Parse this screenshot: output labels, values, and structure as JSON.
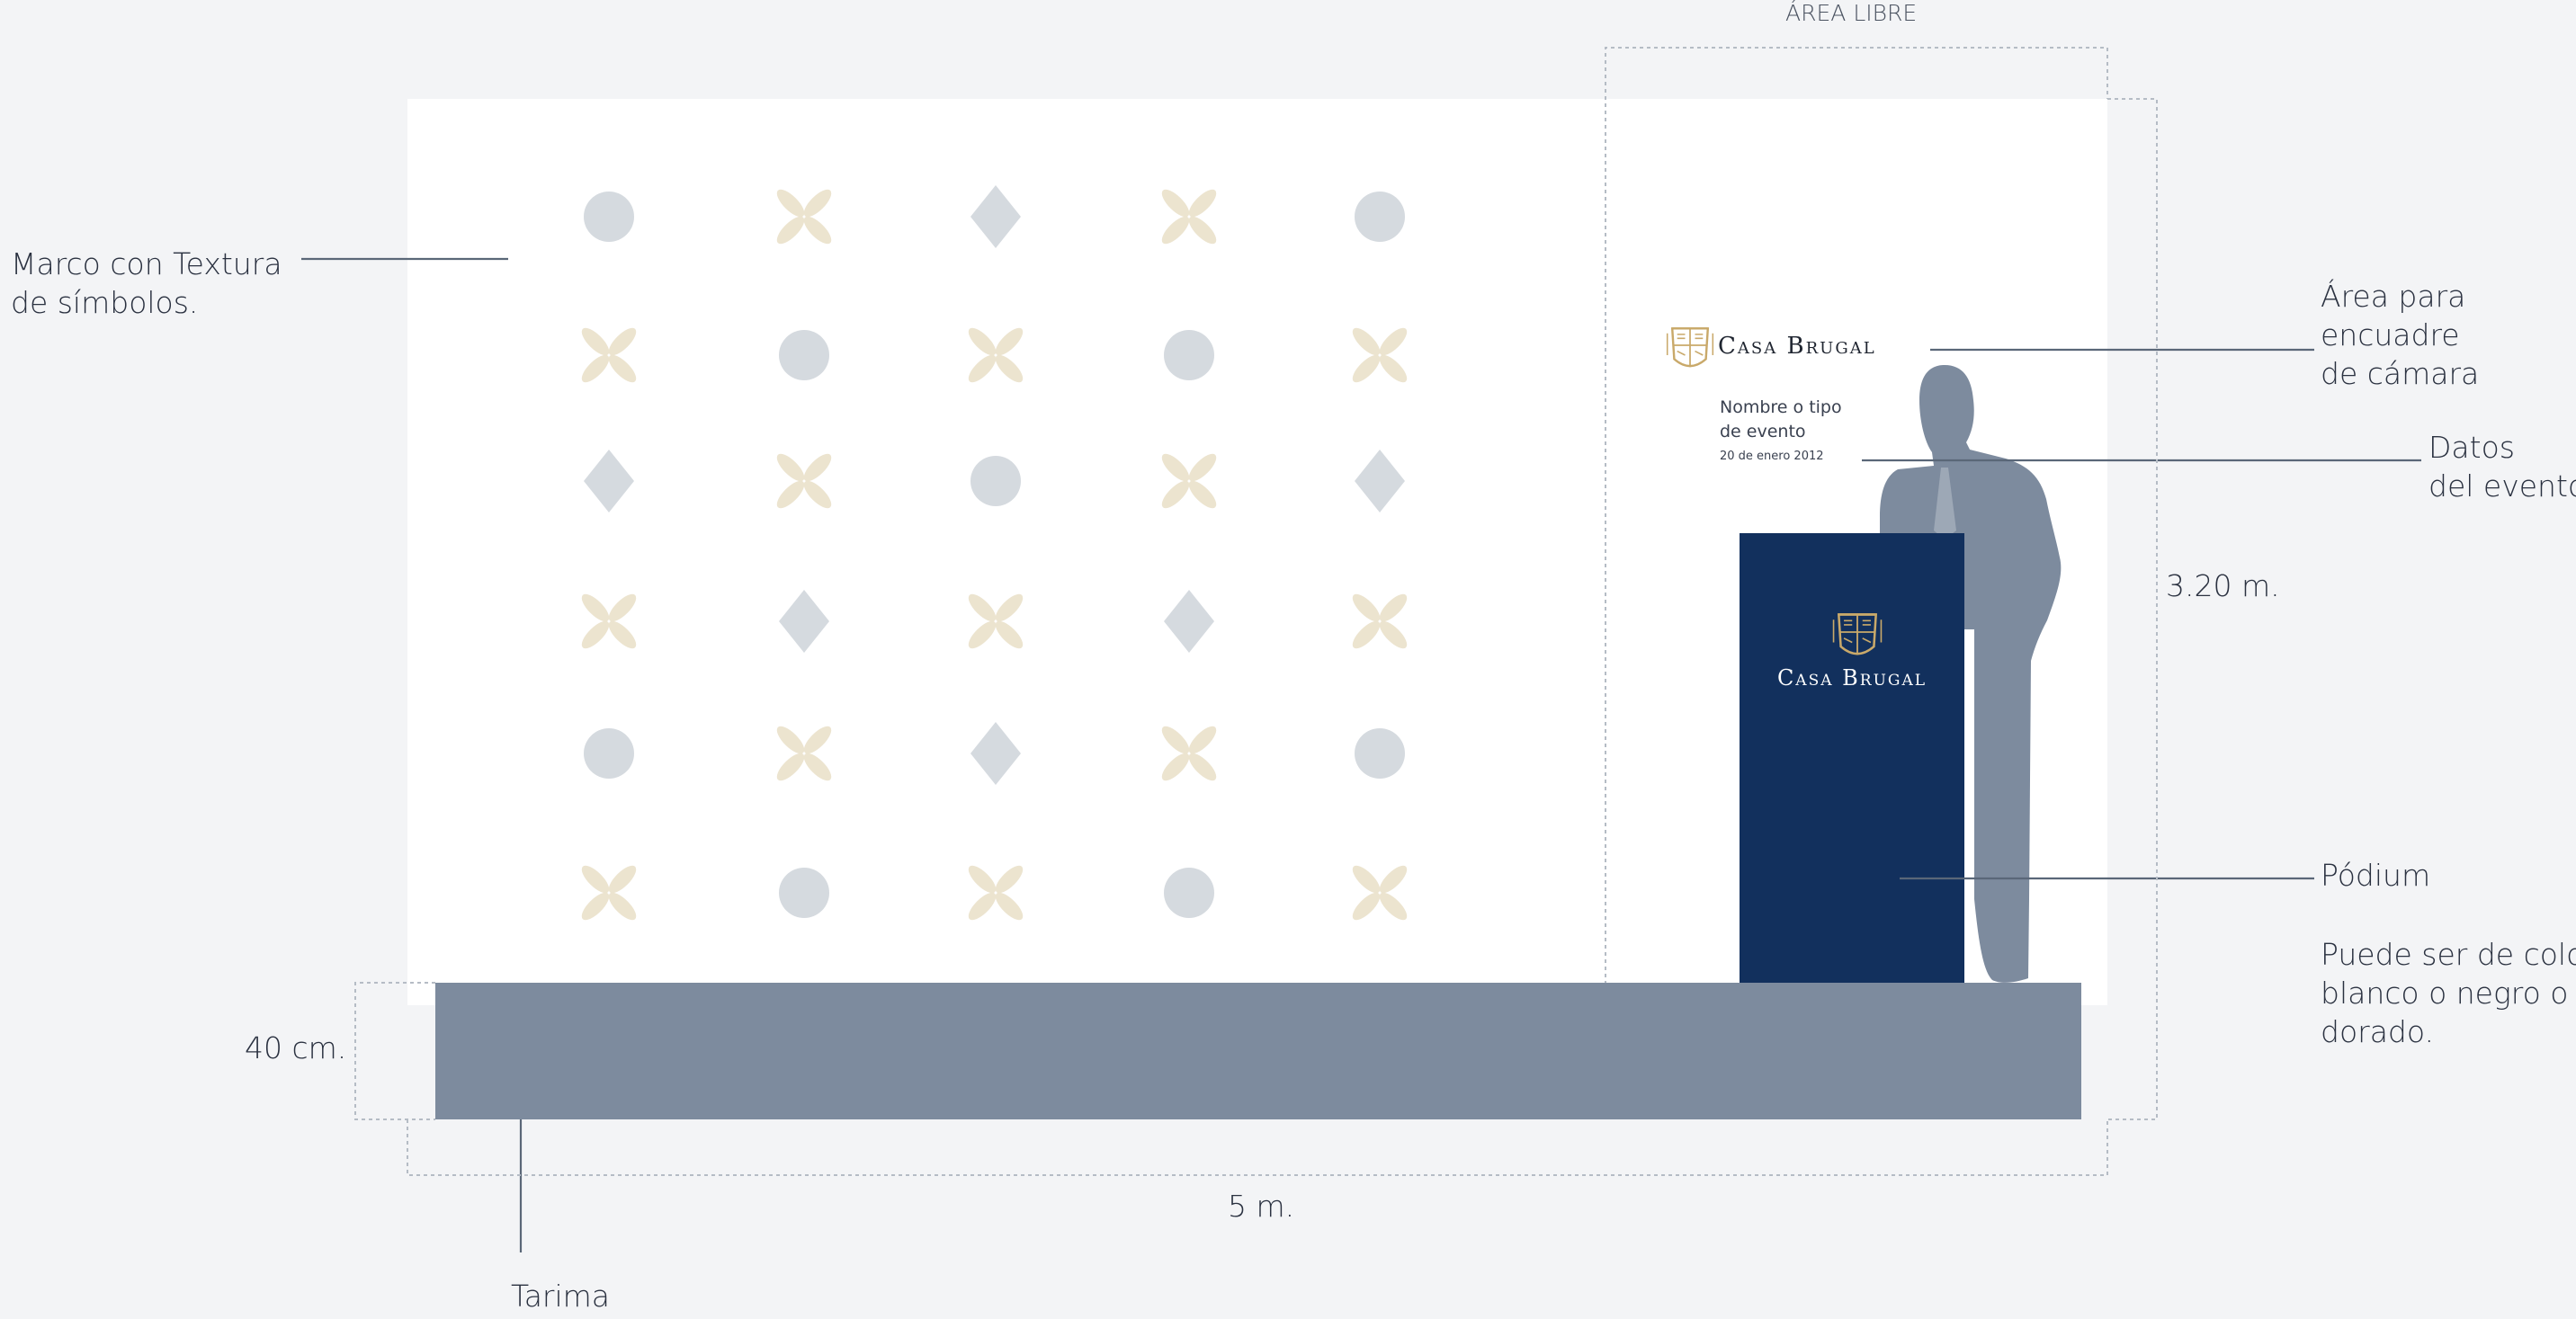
{
  "labels": {
    "area_libre": "ÁREA LIBRE",
    "marco": [
      "Marco con Textura",
      "de símbolos."
    ],
    "area_camara": [
      "Área para",
      "encuadre",
      "de cámara"
    ],
    "datos_evento": [
      "Datos",
      "del evento"
    ],
    "altura": "3.20 m.",
    "podium": "Pódium",
    "podium_note": [
      "Puede ser de color",
      "blanco o negro o",
      "dorado."
    ],
    "tarima_height": "40 cm.",
    "width": "5 m.",
    "tarima": "Tarima"
  },
  "backdrop": {
    "brand": "Casa Brugal",
    "event_name": [
      "Nombre o tipo",
      "de evento"
    ],
    "event_date": "20 de enero 2012"
  },
  "podium": {
    "brand": "Casa Brugal"
  },
  "pattern": {
    "rows": [
      [
        "circle",
        "flower",
        "diamond",
        "flower",
        "circle"
      ],
      [
        "flower",
        "circle",
        "flower",
        "circle",
        "flower"
      ],
      [
        "diamond",
        "flower",
        "circle",
        "flower",
        "diamond"
      ],
      [
        "flower",
        "diamond",
        "flower",
        "diamond",
        "flower"
      ],
      [
        "circle",
        "flower",
        "diamond",
        "flower",
        "circle"
      ],
      [
        "flower",
        "circle",
        "flower",
        "circle",
        "flower"
      ]
    ]
  },
  "colors": {
    "background": "#f3f4f6",
    "backdrop": "#ffffff",
    "stage": "#7d8b9e",
    "podium": "#12305d",
    "person": "#7d8b9e",
    "gold": "#c9a96a",
    "symbol_gray": "#d5dadf",
    "symbol_cream": "#ece4cf",
    "leader_line": "#5a6778",
    "dashed_line": "#b5bcc5"
  }
}
